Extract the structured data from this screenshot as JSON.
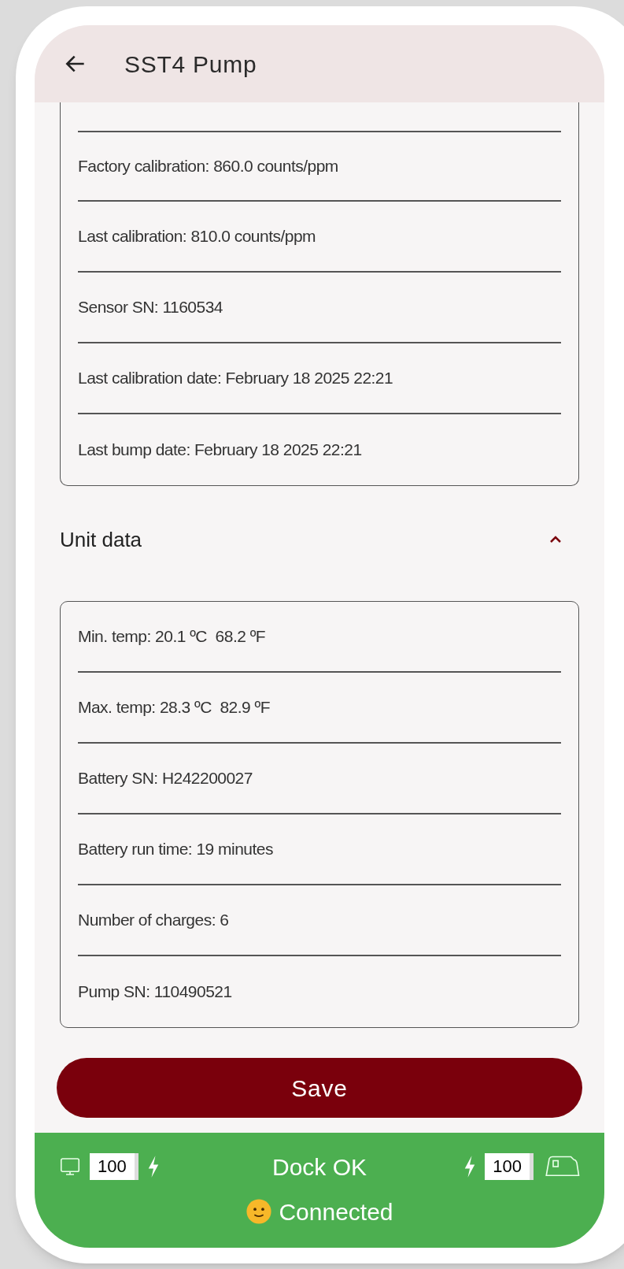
{
  "header": {
    "title": "SST4 Pump"
  },
  "sensor_rows": [
    "Factory calibration: 860.0 counts/ppm",
    "Last calibration: 810.0 counts/ppm",
    "Sensor SN: 1160534",
    "Last calibration date: February 18 2025 22:21",
    "Last bump date: February 18 2025 22:21"
  ],
  "unit_data": {
    "title": "Unit data",
    "expanded": true,
    "rows": [
      "Min. temp: 20.1 ºC  68.2 ºF",
      "Max. temp: 28.3 ºC  82.9 ºF",
      "Battery SN: H242200027",
      "Battery run time: 19 minutes",
      "Number of charges: 6",
      "Pump SN: 110490521"
    ]
  },
  "save_button": "Save",
  "status_bar": {
    "dock_battery": "100",
    "dock_charging": true,
    "status": "Dock OK",
    "pump_charging": true,
    "pump_battery": "100",
    "connection": "Connected"
  }
}
